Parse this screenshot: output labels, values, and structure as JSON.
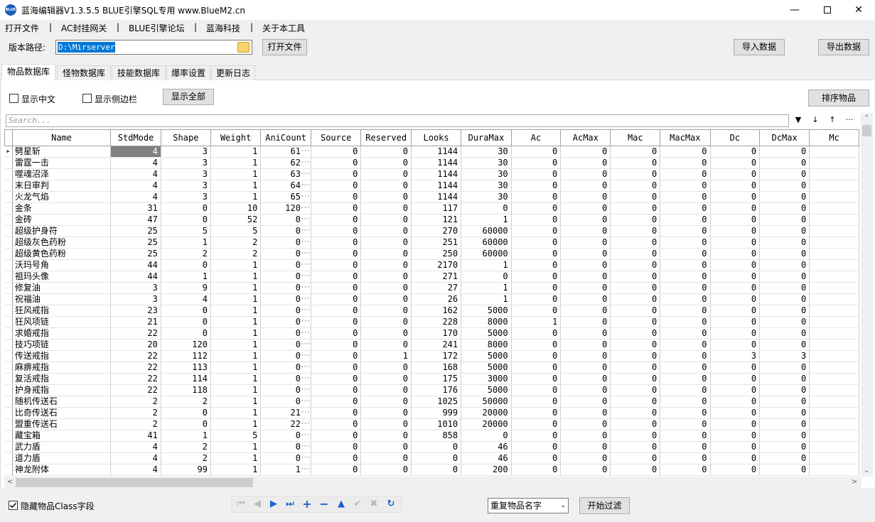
{
  "window": {
    "title": "蓝海编辑器V1.3.5.5  BLUE引擎SQL专用   www.BlueM2.cn",
    "icon_text": "BLUE",
    "minimize": "—",
    "close": "✕"
  },
  "menu": [
    {
      "label": "打开文件"
    },
    {
      "label": "AC封挂网关"
    },
    {
      "label": "BLUE引擎论坛"
    },
    {
      "label": "蓝海科技"
    },
    {
      "label": "关于本工具"
    }
  ],
  "menu_separator": "|",
  "path": {
    "label": "版本路径:",
    "value": "D:\\Mirserver",
    "open_button": "打开文件"
  },
  "toolbar": {
    "import_button": "导入数据",
    "export_button": "导出数据"
  },
  "tabs": [
    {
      "label": "物品数据库"
    },
    {
      "label": "怪物数据库"
    },
    {
      "label": "技能数据库"
    },
    {
      "label": "爆率设置"
    },
    {
      "label": "更新日志"
    }
  ],
  "options": {
    "show_chinese": "显示中文",
    "show_sidebar": "显示侧边栏",
    "show_all_button": "显示全部",
    "sort_button": "排序物品"
  },
  "search": {
    "placeholder": "Search..."
  },
  "grid_icons": {
    "filter": "▼",
    "down": "↓",
    "up": "↑",
    "more": "···"
  },
  "columns": [
    "Name",
    "StdMode",
    "Shape",
    "Weight",
    "AniCount",
    "Source",
    "Reserved",
    "Looks",
    "DuraMax",
    "Ac",
    "AcMax",
    "Mac",
    "MacMax",
    "Dc",
    "DcMax",
    "Mc"
  ],
  "rows": [
    [
      "劈星斩",
      "4",
      "3",
      "1",
      "61",
      "0",
      "0",
      "1144",
      "30",
      "0",
      "0",
      "0",
      "0",
      "0",
      "0",
      ""
    ],
    [
      "雷霆一击",
      "4",
      "3",
      "1",
      "62",
      "0",
      "0",
      "1144",
      "30",
      "0",
      "0",
      "0",
      "0",
      "0",
      "0",
      ""
    ],
    [
      "噬魂沼泽",
      "4",
      "3",
      "1",
      "63",
      "0",
      "0",
      "1144",
      "30",
      "0",
      "0",
      "0",
      "0",
      "0",
      "0",
      ""
    ],
    [
      "末日审判",
      "4",
      "3",
      "1",
      "64",
      "0",
      "0",
      "1144",
      "30",
      "0",
      "0",
      "0",
      "0",
      "0",
      "0",
      ""
    ],
    [
      "火龙气焰",
      "4",
      "3",
      "1",
      "65",
      "0",
      "0",
      "1144",
      "30",
      "0",
      "0",
      "0",
      "0",
      "0",
      "0",
      ""
    ],
    [
      "金条",
      "31",
      "0",
      "10",
      "120",
      "0",
      "0",
      "117",
      "0",
      "0",
      "0",
      "0",
      "0",
      "0",
      "0",
      ""
    ],
    [
      "金砖",
      "47",
      "0",
      "52",
      "0",
      "0",
      "0",
      "121",
      "1",
      "0",
      "0",
      "0",
      "0",
      "0",
      "0",
      ""
    ],
    [
      "超级护身符",
      "25",
      "5",
      "5",
      "0",
      "0",
      "0",
      "270",
      "60000",
      "0",
      "0",
      "0",
      "0",
      "0",
      "0",
      ""
    ],
    [
      "超级灰色药粉",
      "25",
      "1",
      "2",
      "0",
      "0",
      "0",
      "251",
      "60000",
      "0",
      "0",
      "0",
      "0",
      "0",
      "0",
      ""
    ],
    [
      "超级黄色药粉",
      "25",
      "2",
      "2",
      "0",
      "0",
      "0",
      "250",
      "60000",
      "0",
      "0",
      "0",
      "0",
      "0",
      "0",
      ""
    ],
    [
      "沃玛号角",
      "44",
      "0",
      "1",
      "0",
      "0",
      "0",
      "2170",
      "1",
      "0",
      "0",
      "0",
      "0",
      "0",
      "0",
      ""
    ],
    [
      "祖玛头像",
      "44",
      "1",
      "1",
      "0",
      "0",
      "0",
      "271",
      "0",
      "0",
      "0",
      "0",
      "0",
      "0",
      "0",
      ""
    ],
    [
      "修复油",
      "3",
      "9",
      "1",
      "0",
      "0",
      "0",
      "27",
      "1",
      "0",
      "0",
      "0",
      "0",
      "0",
      "0",
      ""
    ],
    [
      "祝福油",
      "3",
      "4",
      "1",
      "0",
      "0",
      "0",
      "26",
      "1",
      "0",
      "0",
      "0",
      "0",
      "0",
      "0",
      ""
    ],
    [
      "狂风戒指",
      "23",
      "0",
      "1",
      "0",
      "0",
      "0",
      "162",
      "5000",
      "0",
      "0",
      "0",
      "0",
      "0",
      "0",
      ""
    ],
    [
      "狂风项链",
      "21",
      "0",
      "1",
      "0",
      "0",
      "0",
      "228",
      "8000",
      "1",
      "0",
      "0",
      "0",
      "0",
      "0",
      ""
    ],
    [
      "求婚戒指",
      "22",
      "0",
      "1",
      "0",
      "0",
      "0",
      "170",
      "5000",
      "0",
      "0",
      "0",
      "0",
      "0",
      "0",
      ""
    ],
    [
      "技巧项链",
      "20",
      "120",
      "1",
      "0",
      "0",
      "0",
      "241",
      "8000",
      "0",
      "0",
      "0",
      "0",
      "0",
      "0",
      ""
    ],
    [
      "传送戒指",
      "22",
      "112",
      "1",
      "0",
      "0",
      "1",
      "172",
      "5000",
      "0",
      "0",
      "0",
      "0",
      "3",
      "3",
      ""
    ],
    [
      "麻痹戒指",
      "22",
      "113",
      "1",
      "0",
      "0",
      "0",
      "168",
      "5000",
      "0",
      "0",
      "0",
      "0",
      "0",
      "0",
      ""
    ],
    [
      "复活戒指",
      "22",
      "114",
      "1",
      "0",
      "0",
      "0",
      "175",
      "3000",
      "0",
      "0",
      "0",
      "0",
      "0",
      "0",
      ""
    ],
    [
      "护身戒指",
      "22",
      "118",
      "1",
      "0",
      "0",
      "0",
      "176",
      "5000",
      "0",
      "0",
      "0",
      "0",
      "0",
      "0",
      ""
    ],
    [
      "随机传送石",
      "2",
      "2",
      "1",
      "0",
      "0",
      "0",
      "1025",
      "50000",
      "0",
      "0",
      "0",
      "0",
      "0",
      "0",
      ""
    ],
    [
      "比奇传送石",
      "2",
      "0",
      "1",
      "21",
      "0",
      "0",
      "999",
      "20000",
      "0",
      "0",
      "0",
      "0",
      "0",
      "0",
      ""
    ],
    [
      "盟重传送石",
      "2",
      "0",
      "1",
      "22",
      "0",
      "0",
      "1010",
      "20000",
      "0",
      "0",
      "0",
      "0",
      "0",
      "0",
      ""
    ],
    [
      "藏宝箱",
      "41",
      "1",
      "5",
      "0",
      "0",
      "0",
      "858",
      "0",
      "0",
      "0",
      "0",
      "0",
      "0",
      "0",
      ""
    ],
    [
      "武力盾",
      "4",
      "2",
      "1",
      "0",
      "0",
      "0",
      "0",
      "46",
      "0",
      "0",
      "0",
      "0",
      "0",
      "0",
      ""
    ],
    [
      "道力盾",
      "4",
      "2",
      "1",
      "0",
      "0",
      "0",
      "0",
      "46",
      "0",
      "0",
      "0",
      "0",
      "0",
      "0",
      ""
    ],
    [
      "神龙附体",
      "4",
      "99",
      "1",
      "1",
      "0",
      "0",
      "0",
      "200",
      "0",
      "0",
      "0",
      "0",
      "0",
      "0",
      ""
    ]
  ],
  "footer": {
    "hide_class_checkbox": "隐藏物品Class字段",
    "duplicate_select": "重复物品名字",
    "filter_button": "开始过滤"
  },
  "nav_icons": [
    "first-icon",
    "prior-icon",
    "next-icon",
    "last-icon",
    "insert-icon",
    "delete-icon",
    "edit-icon",
    "post-icon",
    "cancel-icon",
    "refresh-icon"
  ]
}
